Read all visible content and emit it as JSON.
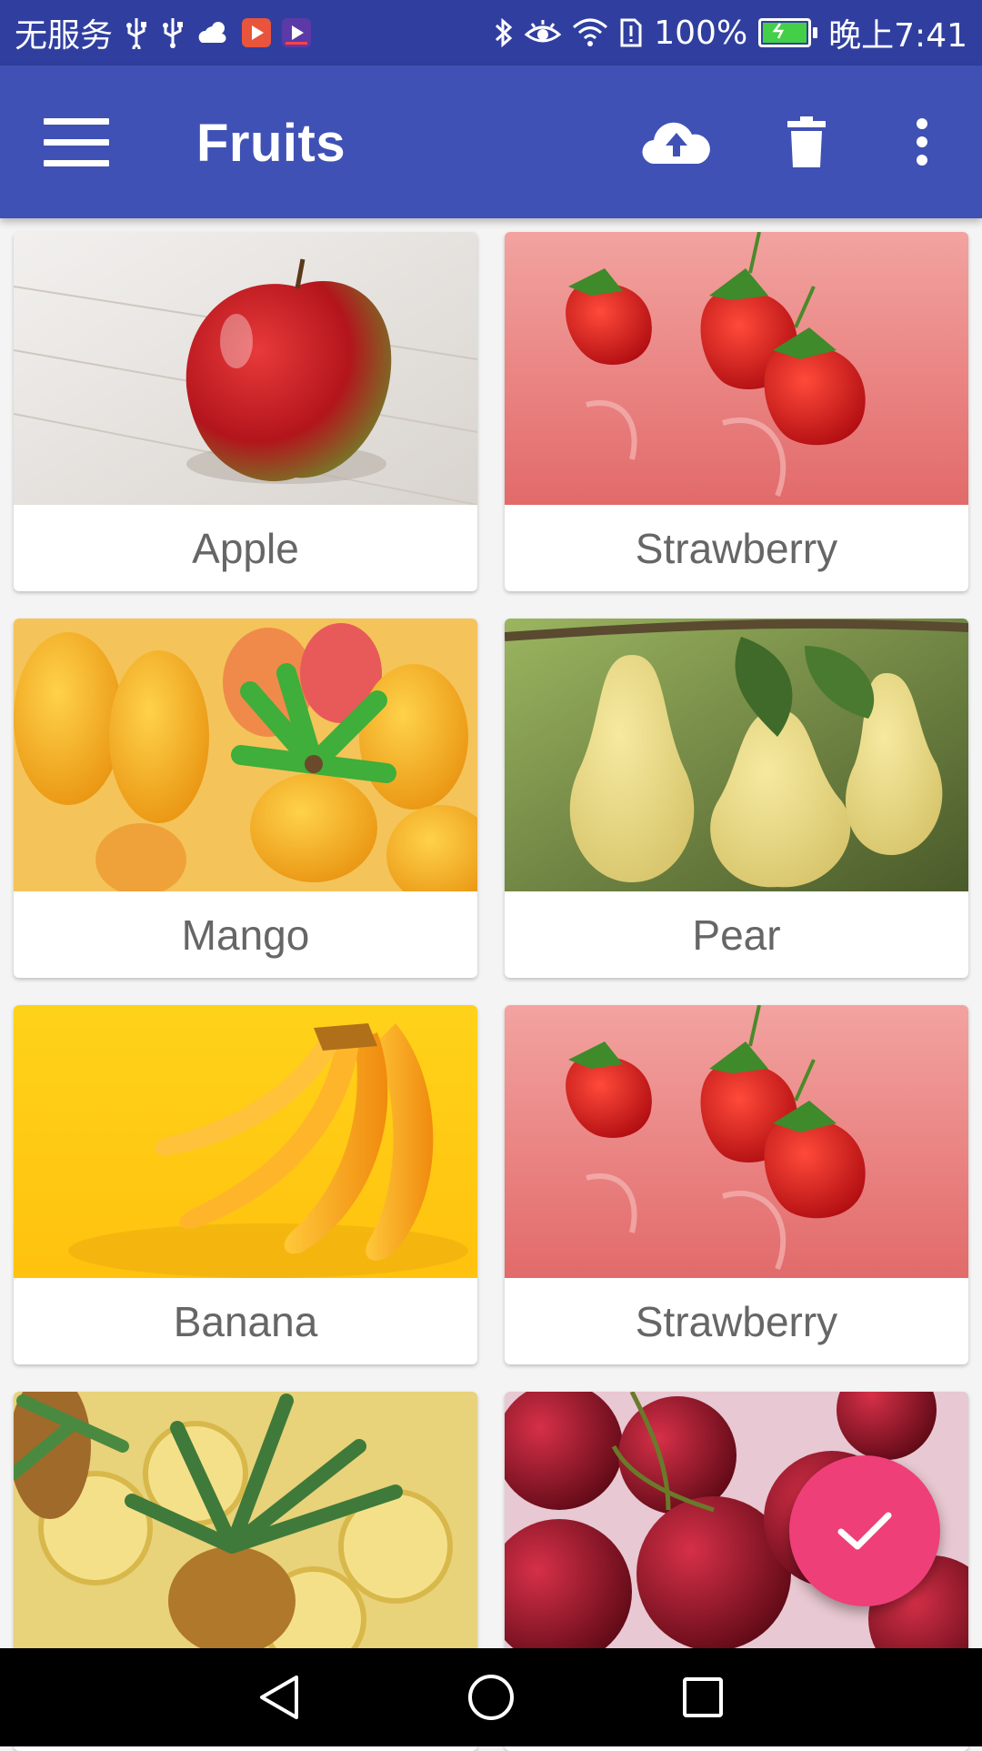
{
  "status_bar": {
    "carrier": "无服务",
    "battery_percent_text": "100%",
    "battery_level": 1.0,
    "time": "晚上7:41",
    "left_icons": [
      "usb-icon",
      "usb-icon",
      "weather-icon",
      "video-app-icon",
      "media-app-icon"
    ],
    "right_icons": [
      "bluetooth-icon",
      "eye-comfort-icon",
      "wifi-icon",
      "sim-error-icon",
      "battery-charging-icon"
    ]
  },
  "app_bar": {
    "title": "Fruits",
    "actions": [
      "menu-icon",
      "cloud-upload-icon",
      "delete-icon",
      "more-vert-icon"
    ],
    "color": "#3f51b5"
  },
  "fruits": [
    {
      "label": "Apple",
      "image": "apple"
    },
    {
      "label": "Strawberry",
      "image": "strawberry"
    },
    {
      "label": "Mango",
      "image": "mango"
    },
    {
      "label": "Pear",
      "image": "pear"
    },
    {
      "label": "Banana",
      "image": "banana"
    },
    {
      "label": "Strawberry",
      "image": "strawberry"
    },
    {
      "label": "",
      "image": "pineapple"
    },
    {
      "label": "",
      "image": "cherry"
    }
  ],
  "fab": {
    "icon": "check-icon",
    "color": "#ef3f78"
  },
  "nav_bar": {
    "buttons": [
      "back-icon",
      "home-icon",
      "recents-icon"
    ]
  }
}
